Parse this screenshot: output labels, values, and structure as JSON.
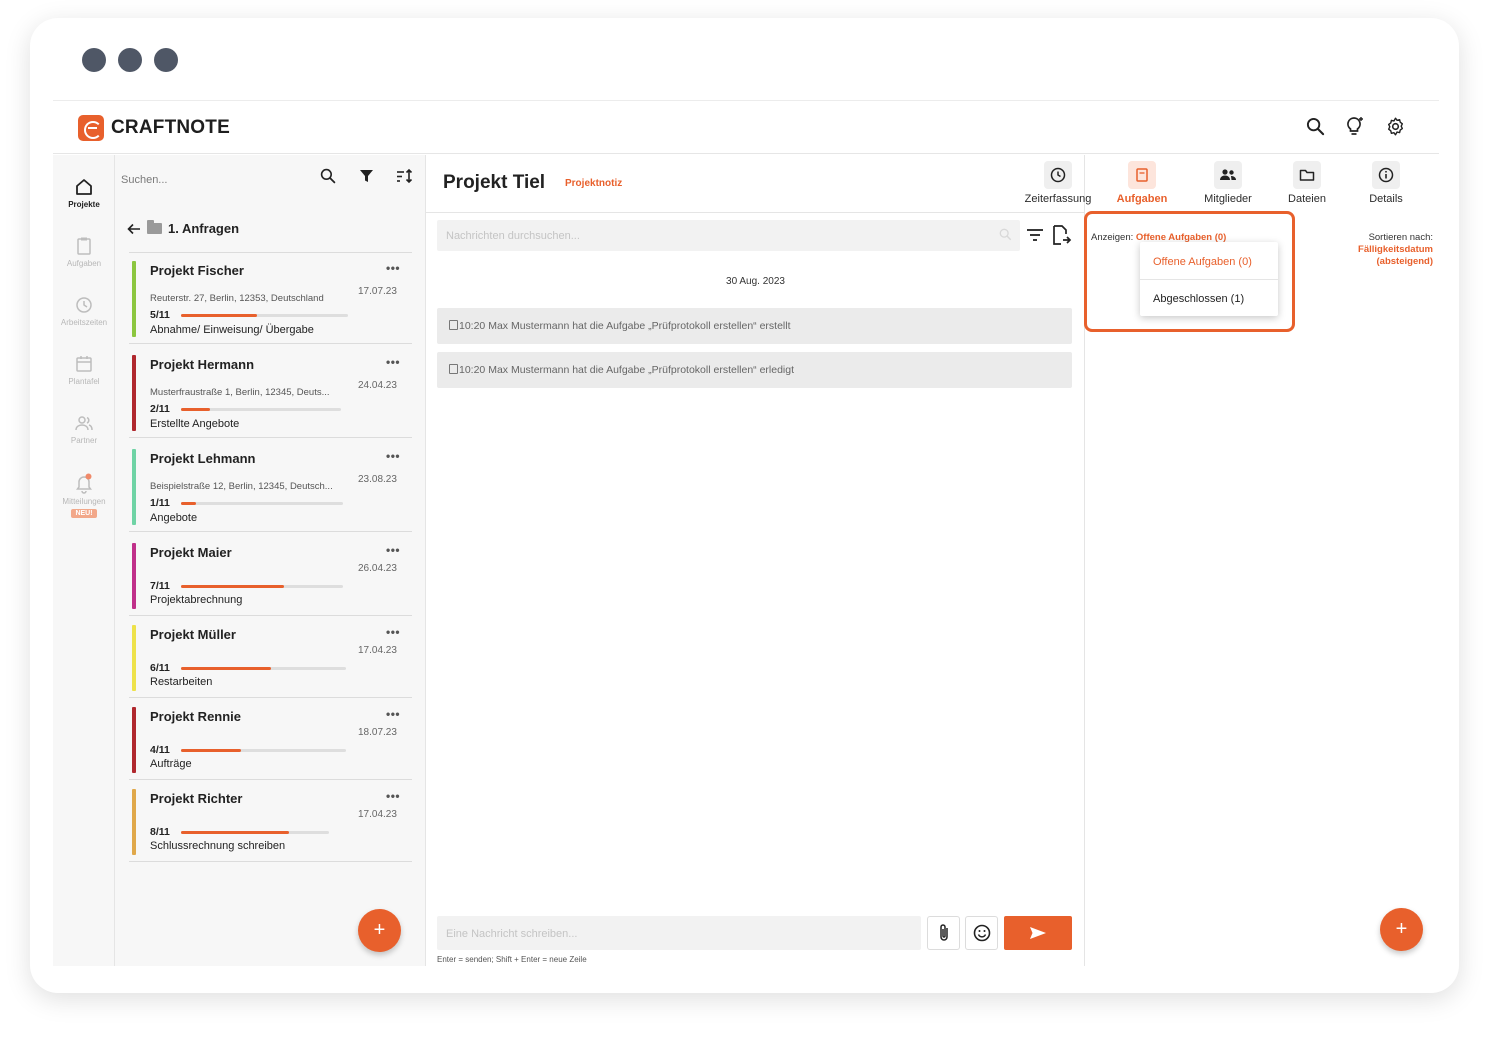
{
  "app": {
    "logo_text": "CRAFTNOTE",
    "accent": "#e8602c"
  },
  "topbar": {
    "icons": [
      "search-icon",
      "lightbulb-icon",
      "gear-icon"
    ]
  },
  "nav": {
    "items": [
      {
        "label": "Projekte",
        "icon": "home-icon",
        "active": true
      },
      {
        "label": "Aufgaben",
        "icon": "clipboard-icon",
        "active": false
      },
      {
        "label": "Arbeitszeiten",
        "icon": "clock-icon",
        "active": false
      },
      {
        "label": "Plantafel",
        "icon": "calendar-icon",
        "active": false
      },
      {
        "label": "Partner",
        "icon": "people-icon",
        "active": false
      },
      {
        "label": "Mitteilungen",
        "icon": "bell-icon",
        "active": false,
        "badge": "NEU!"
      }
    ]
  },
  "list": {
    "search_placeholder": "Suchen...",
    "folder": "1. Anfragen",
    "more_label": "•••",
    "projects": [
      {
        "name": "Projekt Fischer",
        "address": "Reuterstr. 27, Berlin, 12353, Deutschland",
        "date": "17.07.23",
        "progress": "5/11",
        "ratio": 0.4545,
        "stage": "Abnahme/ Einweisung/ Übergabe",
        "color": "#8cc63f"
      },
      {
        "name": "Projekt Hermann",
        "address": "Musterfraustraße 1, Berlin, 12345, Deuts...",
        "date": "24.04.23",
        "progress": "2/11",
        "ratio": 0.1818,
        "stage": "Erstellte Angebote",
        "color": "#b0282e"
      },
      {
        "name": "Projekt Lehmann",
        "address": "Beispielstraße 12, Berlin, 12345, Deutsch...",
        "date": "23.08.23",
        "progress": "1/11",
        "ratio": 0.0909,
        "stage": "Angebote",
        "color": "#6fd3a5"
      },
      {
        "name": "Projekt Maier",
        "address": "",
        "date": "26.04.23",
        "progress": "7/11",
        "ratio": 0.6364,
        "stage": "Projektabrechnung",
        "color": "#c0308a"
      },
      {
        "name": "Projekt Müller",
        "address": "",
        "date": "17.04.23",
        "progress": "6/11",
        "ratio": 0.5455,
        "stage": "Restarbeiten",
        "color": "#eee24a"
      },
      {
        "name": "Projekt Rennie",
        "address": "",
        "date": "18.07.23",
        "progress": "4/11",
        "ratio": 0.3636,
        "stage": "Aufträge",
        "color": "#b0282e"
      },
      {
        "name": "Projekt Richter",
        "address": "",
        "date": "17.04.23",
        "progress": "8/11",
        "ratio": 0.7273,
        "stage": "Schlussrechnung schreiben",
        "color": "#e0a84a"
      }
    ],
    "fab_label": "+"
  },
  "project": {
    "title": "Projekt Tiel",
    "subtitle": "Projektnotiz"
  },
  "tabs": [
    {
      "label": "Zeiterfassung",
      "icon": "clock-icon",
      "active": false
    },
    {
      "label": "Aufgaben",
      "icon": "tasks-icon",
      "active": true
    },
    {
      "label": "Mitglieder",
      "icon": "members-icon",
      "active": false
    },
    {
      "label": "Dateien",
      "icon": "folder-icon",
      "active": false
    },
    {
      "label": "Details",
      "icon": "info-icon",
      "active": false
    }
  ],
  "chat": {
    "search_placeholder": "Nachrichten durchsuchen...",
    "date": "30 Aug. 2023",
    "events": [
      "10:20 Max Mustermann hat die Aufgabe „Prüfprotokoll erstellen“ erstellt",
      "10:20 Max Mustermann hat die Aufgabe „Prüfprotokoll erstellen“ erledigt"
    ],
    "compose_placeholder": "Eine Nachricht schreiben...",
    "hint": "Enter = senden; Shift + Enter = neue Zeile"
  },
  "tasks": {
    "show_prefix": "Anzeigen:",
    "show_value": "Offene Aufgaben (0)",
    "sort_prefix": "Sortieren nach:",
    "sort_value_1": "Fälligkeitsdatum",
    "sort_value_2": "(absteigend)",
    "dropdown": [
      "Offene Aufgaben (0)",
      "Abgeschlossen (1)"
    ],
    "fab_label": "+"
  }
}
